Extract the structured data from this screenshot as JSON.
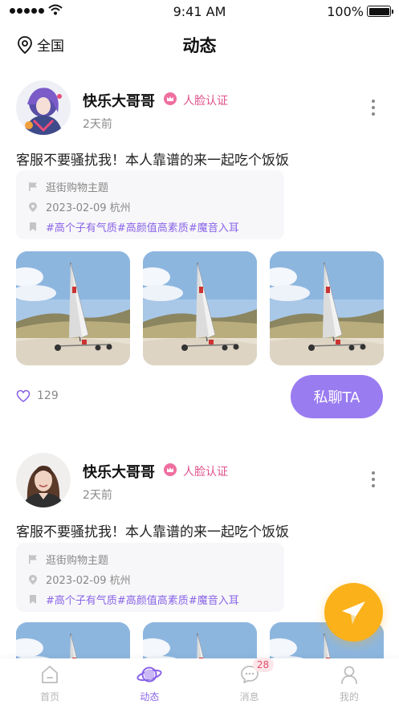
{
  "status_bar": {
    "time": "9:41 AM",
    "battery": "100%"
  },
  "nav": {
    "location": "全国",
    "title": "动态"
  },
  "posts": [
    {
      "username": "快乐大哥哥",
      "verify": "人脸认证",
      "time": "2天前",
      "text": "客服不要骚扰我！本人靠谱的来一起吃个饭饭",
      "topic": "逛街购物主题",
      "date_city": "2023-02-09   杭州",
      "hashtags": [
        "#高个子有气质",
        "#高颜值高素质",
        "#魔音入耳"
      ],
      "likes": "129",
      "chat_label": "私聊TA"
    },
    {
      "username": "快乐大哥哥",
      "verify": "人脸认证",
      "time": "2天前",
      "text": "客服不要骚扰我！本人靠谱的来一起吃个饭饭",
      "topic": "逛街购物主题",
      "date_city": "2023-02-09   杭州",
      "hashtags": [
        "#高个子有气质",
        "#高颜值高素质",
        "#魔音入耳"
      ]
    }
  ],
  "tabs": [
    {
      "label": "首页",
      "icon": "home-icon"
    },
    {
      "label": "动态",
      "icon": "planet-icon"
    },
    {
      "label": "消息",
      "icon": "message-icon",
      "badge": "28"
    },
    {
      "label": "我的",
      "icon": "profile-icon"
    }
  ],
  "colors": {
    "accent": "#8a64e8",
    "chat_button": "#9a7cf1",
    "fab": "#fbb11a",
    "verify": "#e0508a"
  }
}
